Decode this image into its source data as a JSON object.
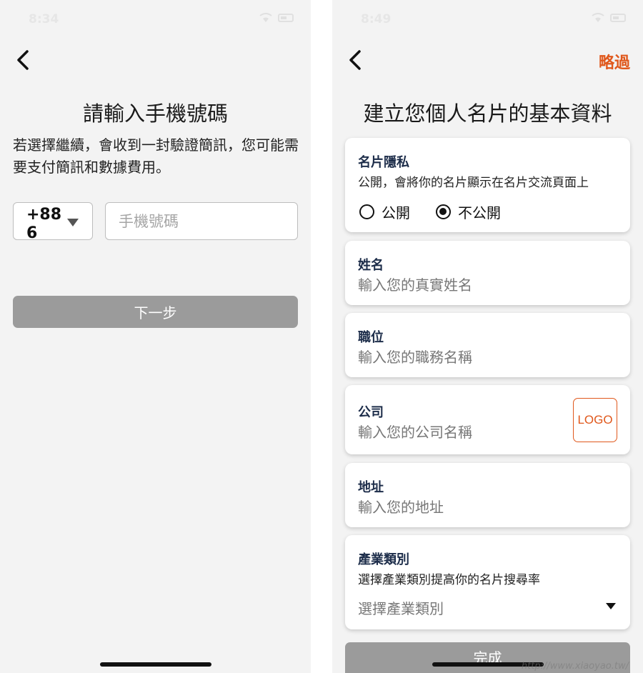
{
  "left": {
    "status_time": "8:34",
    "title": "請輸入手機號碼",
    "description": "若選擇繼續，會收到一封驗證簡訊，您可能需要支付簡訊和數據費用。",
    "country_code": "+886",
    "phone_placeholder": "手機號碼",
    "next_label": "下一步"
  },
  "right": {
    "status_time": "8:49",
    "skip_label": "略過",
    "title": "建立您個人名片的基本資料",
    "privacy": {
      "label": "名片隱私",
      "description": "公開，會將你的名片顯示在名片交流頁面上",
      "options": [
        "公開",
        "不公開"
      ],
      "selected": "不公開"
    },
    "name": {
      "label": "姓名",
      "placeholder": "輸入您的真實姓名"
    },
    "position": {
      "label": "職位",
      "placeholder": "輸入您的職務名稱"
    },
    "company": {
      "label": "公司",
      "placeholder": "輸入您的公司名稱",
      "logo_label": "LOGO"
    },
    "address": {
      "label": "地址",
      "placeholder": "輸入您的地址"
    },
    "industry": {
      "label": "產業類別",
      "description": "選擇產業類別提高你的名片搜尋率",
      "placeholder": "選擇產業類別"
    },
    "done_label": "完成"
  },
  "watermark": "http://www.xiaoyao.tw/",
  "colors": {
    "accent": "#e0581c",
    "button_disabled": "#9b9b9b",
    "background": "#f3f3f3"
  }
}
